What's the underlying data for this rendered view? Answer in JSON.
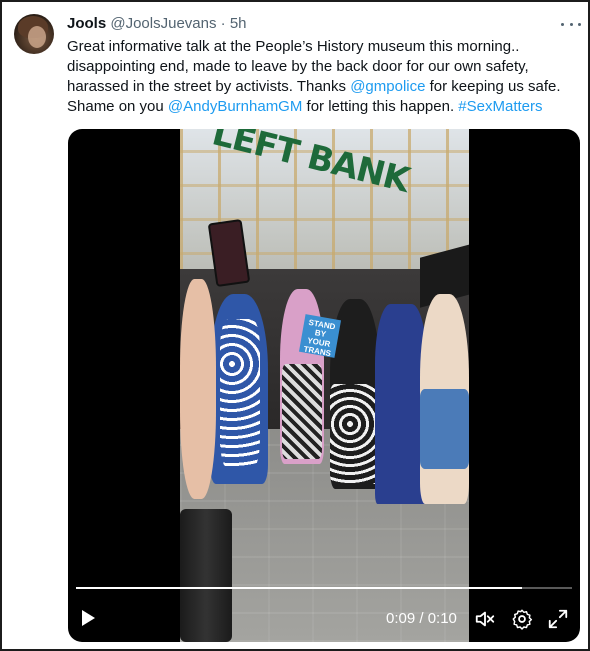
{
  "tweet": {
    "display_name": "Jools",
    "handle": "@JoolsJuevans",
    "separator": "·",
    "time": "5h",
    "text_segments": [
      {
        "text": "Great informative talk at the People’s History museum this morning.. disappointing end, made to leave by the back door for our own safety, harassed in the street by activists. Thanks ",
        "link": false
      },
      {
        "text": "@gmpolice",
        "link": true
      },
      {
        "text": " for keeping us safe. Shame on you ",
        "link": false
      },
      {
        "text": "@AndyBurnhamGM",
        "link": true
      },
      {
        "text": " for letting this happen. ",
        "link": false
      },
      {
        "text": "#SexMatters",
        "link": true
      }
    ]
  },
  "media": {
    "scene_sign_text": "LEFT BANK",
    "placard_text": "STAND BY YOUR TRANS",
    "player": {
      "time_readout": "0:09 / 0:10",
      "progress_fraction": 0.9
    }
  },
  "icons": {
    "more": "more-horizontal-icon",
    "play": "play-icon",
    "mute": "volume-muted-icon",
    "settings": "gear-icon",
    "fullscreen": "fullscreen-icon"
  },
  "colors": {
    "link": "#1d9bf0",
    "secondary_text": "#536471",
    "primary_text": "#0f1419"
  }
}
